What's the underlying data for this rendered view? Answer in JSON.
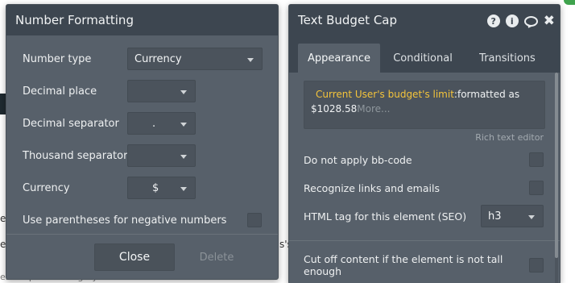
{
  "background": {
    "fragments": [
      "es",
      "e",
      "s's",
      "ese expense category's bu..."
    ]
  },
  "number_formatting": {
    "title": "Number Formatting",
    "number_type": {
      "label": "Number type",
      "value": "Currency"
    },
    "decimal_place": {
      "label": "Decimal place",
      "value": ""
    },
    "decimal_separator": {
      "label": "Decimal separator",
      "value": "."
    },
    "thousand_separator": {
      "label": "Thousand separator",
      "value": ""
    },
    "currency": {
      "label": "Currency",
      "value": "$"
    },
    "parentheses": {
      "label": "Use parentheses for negative numbers",
      "checked": false
    },
    "close_label": "Close",
    "delete_label": "Delete"
  },
  "text_element": {
    "title": "Text Budget Cap",
    "icons": [
      "help-icon",
      "info-icon",
      "comment-icon",
      "close-icon"
    ],
    "icon_glyphs": {
      "help": "?",
      "info": "i",
      "close": "✖"
    },
    "tabs": [
      {
        "label": "Appearance",
        "active": true
      },
      {
        "label": "Conditional",
        "active": false
      },
      {
        "label": "Transitions",
        "active": false
      }
    ],
    "content": {
      "dynamic_expression": "Current User's budget's limit",
      "expression_suffix": ":formatted as",
      "formatted_value": "$1028.58",
      "more_label": "More..."
    },
    "rich_text_editor_label": "Rich text editor",
    "options": {
      "no_bbcode": {
        "label": "Do not apply bb-code",
        "checked": false
      },
      "recognize_links": {
        "label": "Recognize links and emails",
        "checked": false
      },
      "html_tag": {
        "label": "HTML tag for this element (SEO)",
        "value": "h3"
      },
      "cut_off": {
        "label": "Cut off content if the element is not tall enough",
        "checked": false
      }
    },
    "colors": {
      "dynamic_text": "#f4c43b",
      "panel": "#57606a",
      "header": "#3d4650"
    }
  }
}
